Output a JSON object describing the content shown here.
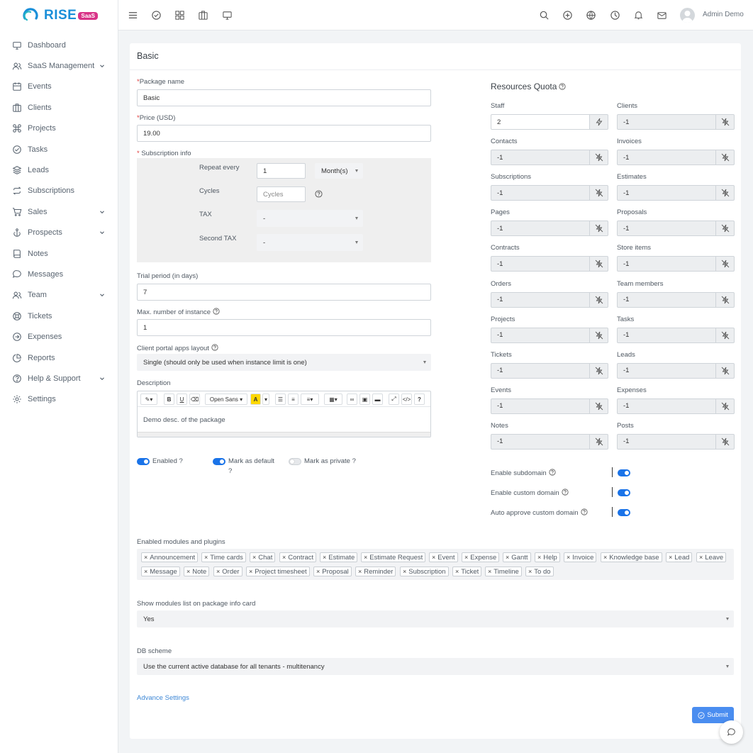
{
  "brand": {
    "name": "RISE",
    "badge": "SaaS"
  },
  "sidebar": {
    "items": [
      {
        "label": "Dashboard",
        "icon": "monitor-icon",
        "has_submenu": false
      },
      {
        "label": "SaaS Management",
        "icon": "users-icon",
        "has_submenu": true
      },
      {
        "label": "Events",
        "icon": "calendar-icon",
        "has_submenu": false
      },
      {
        "label": "Clients",
        "icon": "briefcase-icon",
        "has_submenu": false
      },
      {
        "label": "Projects",
        "icon": "command-icon",
        "has_submenu": false
      },
      {
        "label": "Tasks",
        "icon": "check-circle-icon",
        "has_submenu": false
      },
      {
        "label": "Leads",
        "icon": "layers-icon",
        "has_submenu": false
      },
      {
        "label": "Subscriptions",
        "icon": "repeat-icon",
        "has_submenu": false
      },
      {
        "label": "Sales",
        "icon": "cart-icon",
        "has_submenu": true
      },
      {
        "label": "Prospects",
        "icon": "anchor-icon",
        "has_submenu": true
      },
      {
        "label": "Notes",
        "icon": "book-icon",
        "has_submenu": false
      },
      {
        "label": "Messages",
        "icon": "message-icon",
        "has_submenu": false
      },
      {
        "label": "Team",
        "icon": "users-icon",
        "has_submenu": true
      },
      {
        "label": "Tickets",
        "icon": "life-buoy-icon",
        "has_submenu": false
      },
      {
        "label": "Expenses",
        "icon": "arrow-circle-icon",
        "has_submenu": false
      },
      {
        "label": "Reports",
        "icon": "pie-chart-icon",
        "has_submenu": false
      },
      {
        "label": "Help & Support",
        "icon": "help-circle-icon",
        "has_submenu": true
      },
      {
        "label": "Settings",
        "icon": "gear-icon",
        "has_submenu": false
      }
    ]
  },
  "topbar": {
    "user_name": "Admin Demo"
  },
  "form": {
    "title": "Basic",
    "package_name_label": "Package name",
    "package_name_value": "Basic",
    "price_label": "Price (USD)",
    "price_value": "19.00",
    "subscription_label": "Subscription info",
    "repeat_label": "Repeat every",
    "repeat_value": "1",
    "repeat_unit": "Month(s)",
    "cycles_label": "Cycles",
    "cycles_placeholder": "Cycles",
    "tax_label": "TAX",
    "tax_value": "-",
    "second_tax_label": "Second TAX",
    "second_tax_value": "-",
    "trial_label": "Trial period (in days)",
    "trial_value": "7",
    "max_instance_label": "Max. number of instance",
    "max_instance_value": "1",
    "portal_layout_label": "Client portal apps layout",
    "portal_layout_value": "Single (should only be used when instance limit is one)",
    "description_label": "Description",
    "description_text": "Demo desc. of the package",
    "editor_font": "Open Sans",
    "enabled_label": "Enabled ?",
    "default_label_1": "Mark as default",
    "default_label_2": "?",
    "private_label": "Mark as private ?",
    "modules_label": "Enabled modules and plugins",
    "modules": [
      "Announcement",
      "Time cards",
      "Chat",
      "Contract",
      "Estimate",
      "Estimate Request",
      "Event",
      "Expense",
      "Gantt",
      "Help",
      "Invoice",
      "Knowledge base",
      "Lead",
      "Leave",
      "Message",
      "Note",
      "Order",
      "Project timesheet",
      "Proposal",
      "Reminder",
      "Subscription",
      "Ticket",
      "Timeline",
      "To do"
    ],
    "show_modules_label": "Show modules list on package info card",
    "show_modules_value": "Yes",
    "db_label": "DB scheme",
    "db_value": "Use the current active database for all tenants - multitenancy",
    "advance_link": "Advance Settings",
    "submit_label": "Submit"
  },
  "quota": {
    "title": "Resources Quota",
    "items": [
      {
        "label": "Staff",
        "value": "2",
        "unlimited": false
      },
      {
        "label": "Clients",
        "value": "-1",
        "unlimited": true
      },
      {
        "label": "Contacts",
        "value": "-1",
        "unlimited": true
      },
      {
        "label": "Invoices",
        "value": "-1",
        "unlimited": true
      },
      {
        "label": "Subscriptions",
        "value": "-1",
        "unlimited": true
      },
      {
        "label": "Estimates",
        "value": "-1",
        "unlimited": true
      },
      {
        "label": "Pages",
        "value": "-1",
        "unlimited": true
      },
      {
        "label": "Proposals",
        "value": "-1",
        "unlimited": true
      },
      {
        "label": "Contracts",
        "value": "-1",
        "unlimited": true
      },
      {
        "label": "Store items",
        "value": "-1",
        "unlimited": true
      },
      {
        "label": "Orders",
        "value": "-1",
        "unlimited": true
      },
      {
        "label": "Team members",
        "value": "-1",
        "unlimited": true
      },
      {
        "label": "Projects",
        "value": "-1",
        "unlimited": true
      },
      {
        "label": "Tasks",
        "value": "-1",
        "unlimited": true
      },
      {
        "label": "Tickets",
        "value": "-1",
        "unlimited": true
      },
      {
        "label": "Leads",
        "value": "-1",
        "unlimited": true
      },
      {
        "label": "Events",
        "value": "-1",
        "unlimited": true
      },
      {
        "label": "Expenses",
        "value": "-1",
        "unlimited": true
      },
      {
        "label": "Notes",
        "value": "-1",
        "unlimited": true
      },
      {
        "label": "Posts",
        "value": "-1",
        "unlimited": true
      }
    ],
    "domain_settings": [
      {
        "label": "Enable subdomain",
        "enabled": true
      },
      {
        "label": "Enable custom domain",
        "enabled": true
      },
      {
        "label": "Auto approve custom domain",
        "enabled": true
      }
    ]
  },
  "colors": {
    "accent": "#1a73e8",
    "brand": "#1a8fd9",
    "badge": "#d83387",
    "submit": "#4a8df0"
  }
}
